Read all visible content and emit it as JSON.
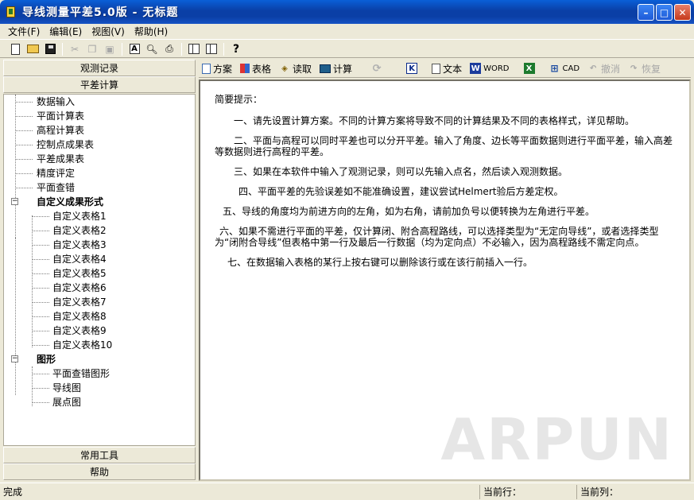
{
  "window": {
    "title": "导线测量平差5.0版 - 无标题"
  },
  "menu": [
    "文件(F)",
    "编辑(E)",
    "视图(V)",
    "帮助(H)"
  ],
  "left": {
    "header1": "观测记录",
    "header2": "平差计算",
    "tree": [
      "数据输入",
      "平面计算表",
      "高程计算表",
      "控制点成果表",
      "平差成果表",
      "精度评定",
      "平面查错",
      "自定义成果形式",
      "自定义表格1",
      "自定义表格2",
      "自定义表格3",
      "自定义表格4",
      "自定义表格5",
      "自定义表格6",
      "自定义表格7",
      "自定义表格8",
      "自定义表格9",
      "自定义表格10",
      "图形",
      "平面查错图形",
      "导线图",
      "展点图"
    ],
    "bottom1": "常用工具",
    "bottom2": "帮助"
  },
  "right": {
    "toolbar": {
      "scheme": "方案",
      "table": "表格",
      "read": "读取",
      "calc": "计算",
      "text": "文本",
      "word": "WORD",
      "cad": "CAD",
      "undo": "撤消",
      "redo": "恢复"
    },
    "hint_title": "简要提示：",
    "hints": [
      "一、请先设置计算方案。不同的计算方案将导致不同的计算结果及不同的表格样式，详见帮助。",
      "二、平面与高程可以同时平差也可以分开平差。输入了角度、边长等平面数据则进行平面平差，输入高差等数据则进行高程的平差。",
      "三、如果在本软件中输入了观测记录，则可以先输入点名，然后读入观测数据。",
      "四、平面平差的先验误差如不能准确设置，建议尝试Helmert验后方差定权。",
      "五、导线的角度均为前进方向的左角，如为右角，请前加负号以便转换为左角进行平差。",
      "六、如果不需进行平面的平差，仅计算闭、附合高程路线，可以选择类型为“无定向导线”，或者选择类型为“闭附合导线”但表格中第一行及最后一行数据（均为定向点）不必输入，因为高程路线不需定向点。",
      "七、在数据输入表格的某行上按右键可以删除该行或在该行前插入一行。"
    ]
  },
  "status": {
    "left": "完成",
    "row_label": "当前行：",
    "col_label": "当前列："
  },
  "watermark": "ARPUN"
}
